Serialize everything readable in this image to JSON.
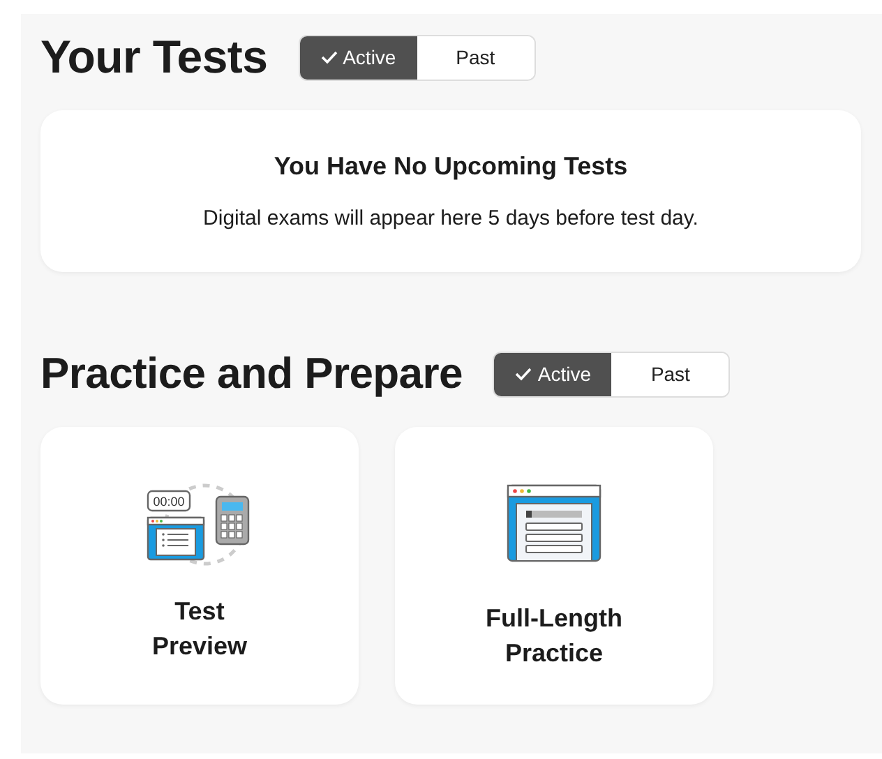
{
  "your_tests": {
    "title": "Your Tests",
    "toggle": [
      {
        "label": "Active",
        "selected": true
      },
      {
        "label": "Past",
        "selected": false
      }
    ],
    "empty_card": {
      "title": "You Have No Upcoming Tests",
      "message": "Digital exams will appear here 5 days before test day."
    }
  },
  "practice": {
    "title": "Practice and Prepare",
    "toggle": [
      {
        "label": "Active",
        "selected": true
      },
      {
        "label": "Past",
        "selected": false
      }
    ],
    "cards": [
      {
        "kind": "preview",
        "timer": "00:00",
        "lines": [
          "Test",
          "Preview"
        ]
      },
      {
        "kind": "full",
        "lines": [
          "Full-Length",
          "Practice"
        ]
      }
    ]
  }
}
